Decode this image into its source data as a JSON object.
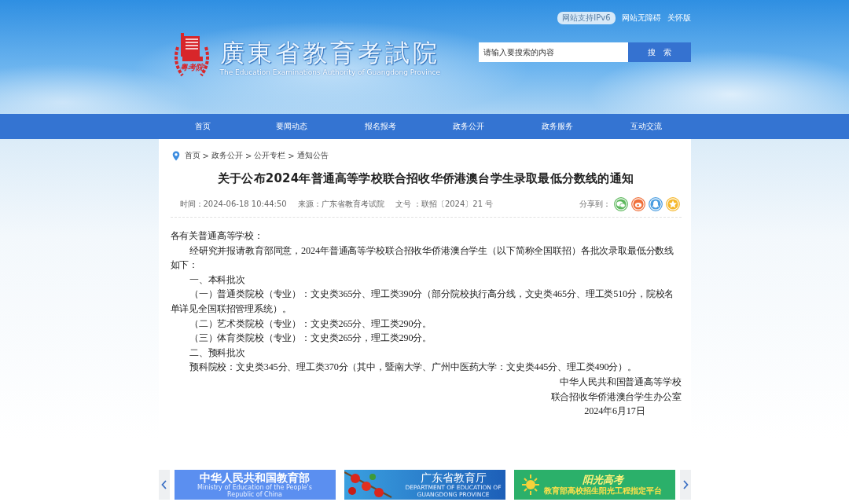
{
  "top_links": [
    {
      "label": "网站支持IPv6",
      "kind": "pill"
    },
    {
      "label": "网站无障碍",
      "kind": "link"
    },
    {
      "label": "关怀版",
      "kind": "link"
    }
  ],
  "logo": {
    "seal": "粤考院",
    "title": "廣東省教育考試院",
    "subtitle": "The Education Examinations Authority of Guangdong Province"
  },
  "search": {
    "placeholder": "请输入要搜索的内容",
    "button": "搜　索"
  },
  "nav": [
    {
      "label": "首页"
    },
    {
      "label": "要闻动态"
    },
    {
      "label": "报名报考"
    },
    {
      "label": "政务公开"
    },
    {
      "label": "政务服务"
    },
    {
      "label": "互动交流"
    }
  ],
  "breadcrumb": [
    "首页",
    "政务公开",
    "公开专栏",
    "通知公告"
  ],
  "breadcrumb_separator": ">",
  "article": {
    "title": "关于公布2024年普通高等学校联合招收华侨港澳台学生录取最低分数线的通知",
    "meta": [
      "时间：2024-06-18 10:44:50",
      "来源：广东省教育考试院",
      "文号 ：联招〔2024〕21 号"
    ],
    "share_label": "分享到：",
    "share": [
      {
        "kind": "wechat",
        "color": "#5cb85c"
      },
      {
        "kind": "weibo",
        "color": "#f0703a"
      },
      {
        "kind": "qq",
        "color": "#4a9de0"
      },
      {
        "kind": "star",
        "color": "#f5b72a"
      }
    ],
    "paragraphs": [
      {
        "kind": "plain",
        "text": "各有关普通高等学校："
      },
      {
        "kind": "indent",
        "text": "经研究并报请教育部同意，2024年普通高等学校联合招收华侨港澳台学生（以下简称全国联招）各批次录取最低分数线如下："
      },
      {
        "kind": "indent",
        "text": "一、本科批次"
      },
      {
        "kind": "indent",
        "text": "（一）普通类院校（专业）：文史类365分、理工类390分（部分院校执行高分线，文史类465分、理工类510分，院校名单详见全国联招管理系统）。"
      },
      {
        "kind": "indent",
        "text": "（二）艺术类院校（专业）：文史类265分、理工类290分。"
      },
      {
        "kind": "indent",
        "text": "（三）体育类院校（专业）：文史类265分，理工类290分。"
      },
      {
        "kind": "indent",
        "text": "二、预科批次"
      },
      {
        "kind": "indent",
        "text": "预科院校：文史类345分、理工类370分（其中，暨南大学、广州中医药大学：文史类445分、理工类490分）。"
      },
      {
        "kind": "right",
        "text": "中华人民共和国普通高等学校"
      },
      {
        "kind": "right",
        "text": "联合招收华侨港澳台学生办公室"
      },
      {
        "kind": "date",
        "text": "2024年6月17日"
      }
    ]
  },
  "banners": [
    {
      "kind": "ministry",
      "title": "中华人民共和国教育部",
      "subtitle": "Ministry of Education of the People's Republic of China"
    },
    {
      "kind": "department",
      "title": "广东省教育厅",
      "subtitle": "DEPARTMENT OF EDUCATION OF GUANGDONG PROVINCE"
    },
    {
      "kind": "sunshine",
      "title": "阳光高考",
      "subtitle": "教育部高校招生阳光工程指定平台"
    }
  ]
}
